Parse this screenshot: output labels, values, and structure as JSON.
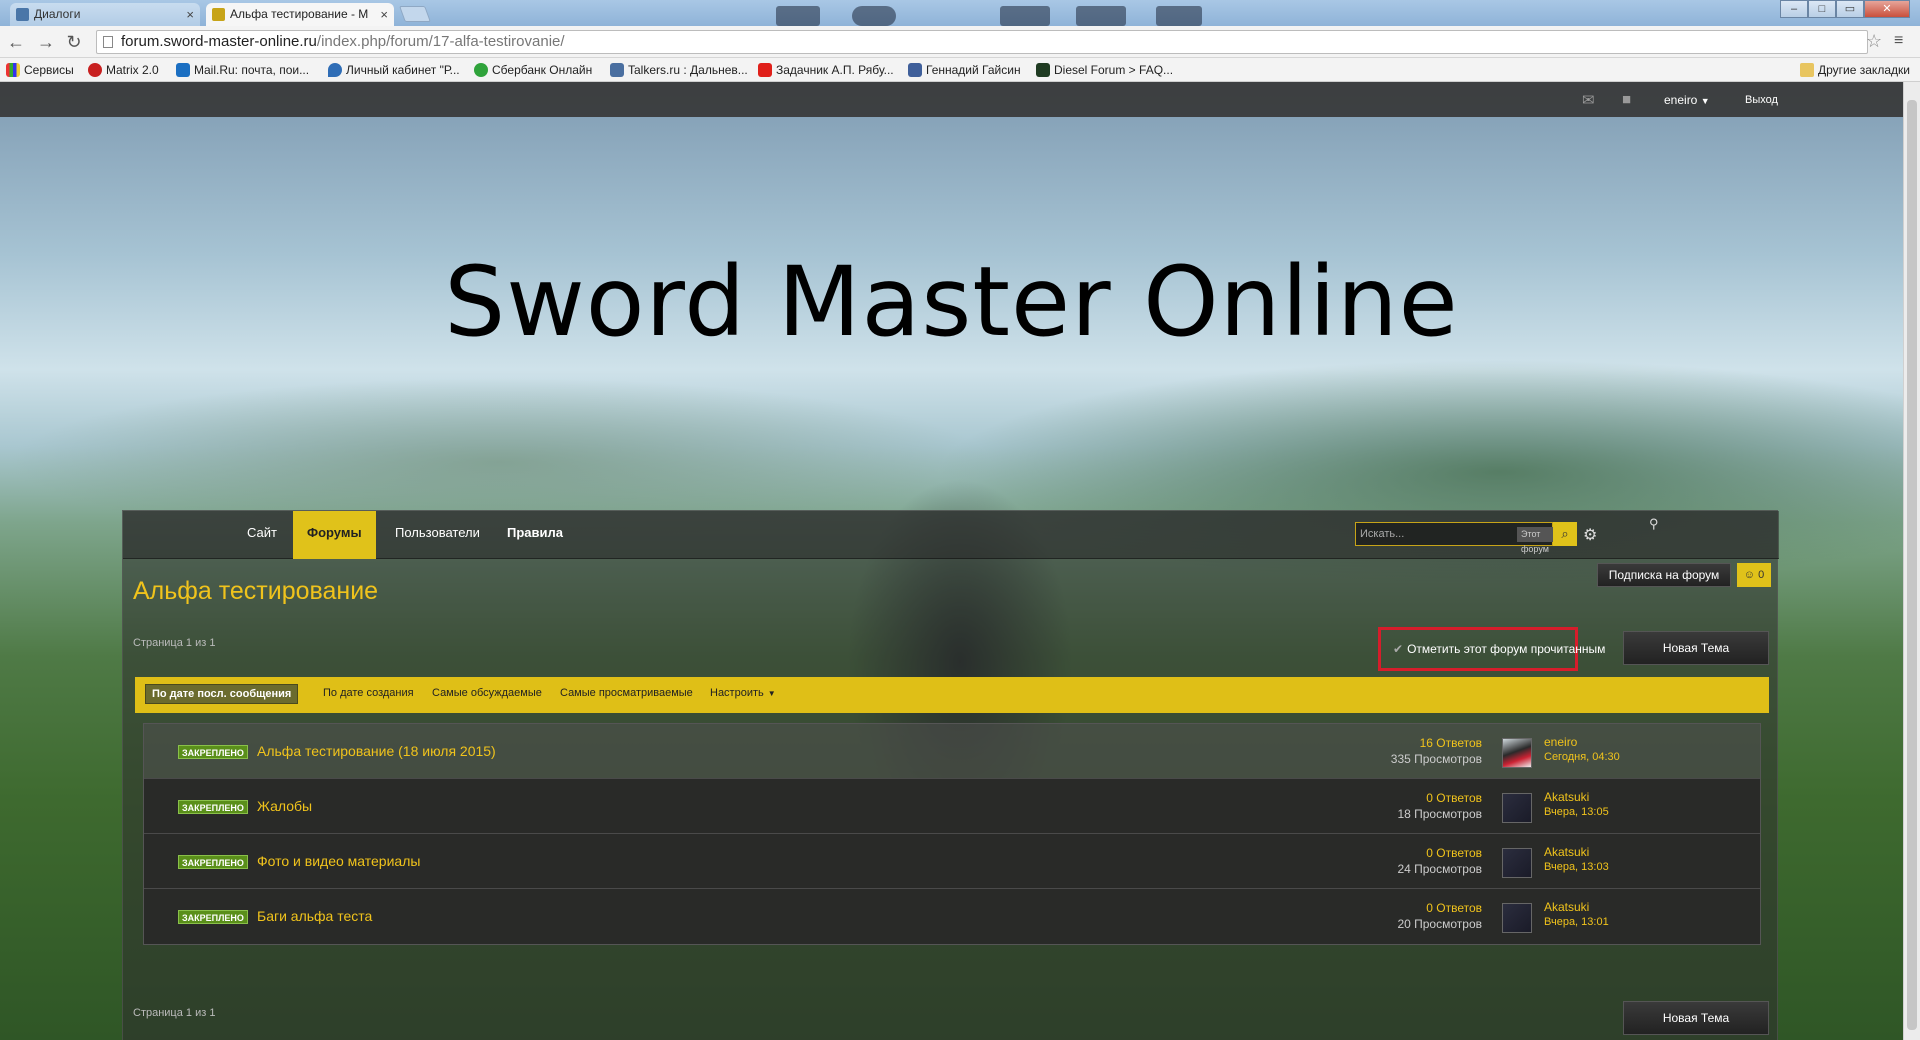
{
  "browser": {
    "tabs": [
      {
        "label": "Диалоги",
        "state": "inactive"
      },
      {
        "label": "Альфа тестирование - M",
        "state": "active"
      }
    ],
    "address": {
      "host": "forum.sword-master-online.ru",
      "path": "/index.php/forum/17-alfa-testirovanie/"
    },
    "bookmarks": [
      "Сервисы",
      "Matrix 2.0",
      "Mail.Ru: почта, пои...",
      "Личный кабинет \"Р...",
      "Сбербанк Онлайн",
      "Talkers.ru : Дальнев...",
      "Задачник А.П. Рябу...",
      "Геннадий Гайсин",
      "Diesel Forum > FAQ...",
      "Другие закладки"
    ]
  },
  "userbar": {
    "username": "eneiro",
    "logout": "Выход"
  },
  "logo_text": "Sword Master Online",
  "nav": {
    "tabs": [
      "Сайт",
      "Форумы",
      "Пользователи",
      "Правила"
    ],
    "active_index": 1,
    "search_placeholder": "Искать...",
    "search_scope": "Этот форум"
  },
  "forum": {
    "title": "Альфа тестирование",
    "page_info": "Страница 1 из 1",
    "subscribe_label": "Подписка на форум",
    "follow_count": "0",
    "mark_read_label": "Отметить этот форум прочитанным",
    "new_topic_label": "Новая Тема"
  },
  "sort": {
    "options": [
      "По дате посл. сообщения",
      "По дате создания",
      "Самые обсуждаемые",
      "Самые просматриваемые",
      "Настроить"
    ],
    "active_index": 0
  },
  "topics": [
    {
      "badge": "ЗАКРЕПЛЕНО",
      "title": "Альфа тестирование (18 июля 2015)",
      "replies": "16 Ответов",
      "views": "335 Просмотров",
      "last_user": "eneiro",
      "last_date": "Сегодня, 04:30"
    },
    {
      "badge": "ЗАКРЕПЛЕНО",
      "title": "Жалобы",
      "replies": "0 Ответов",
      "views": "18 Просмотров",
      "last_user": "Akatsuki",
      "last_date": "Вчера, 13:05"
    },
    {
      "badge": "ЗАКРЕПЛЕНО",
      "title": "Фото и видео материалы",
      "replies": "0 Ответов",
      "views": "24 Просмотров",
      "last_user": "Akatsuki",
      "last_date": "Вчера, 13:03"
    },
    {
      "badge": "ЗАКРЕПЛЕНО",
      "title": "Баги альфа теста",
      "replies": "0 Ответов",
      "views": "20 Просмотров",
      "last_user": "Akatsuki",
      "last_date": "Вчера, 13:01"
    }
  ],
  "colors": {
    "accent": "#e0c21a",
    "link": "#f0c31c",
    "highlight_box": "#d61d2b",
    "pinned": "#5a8f1a"
  }
}
